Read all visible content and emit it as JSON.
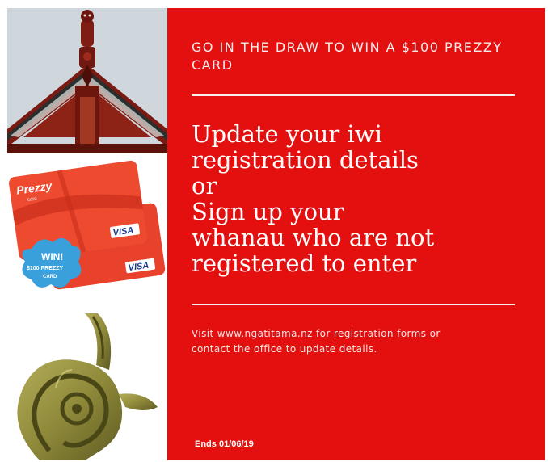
{
  "poster": {
    "headline_small": "GO IN THE DRAW TO WIN A $100 PREZZY CARD",
    "main_lines": [
      "Update your iwi",
      "registration details",
      "or",
      "Sign up your",
      "whanau who are not",
      "registered to enter"
    ],
    "body_text": "Visit www.ngatitama.nz for registration forms or contact the office to update details.",
    "ends": "Ends 01/06/19"
  },
  "prezzy_card": {
    "brand": "Prezzy",
    "brand_sub": "card",
    "card_network": "VISA",
    "badge_line1": "WIN!",
    "badge_line2": "$100 PREZZY",
    "badge_line3": "CARD"
  },
  "colors": {
    "panel_red": "#e41010",
    "card_red": "#e8412c",
    "badge_blue": "#3aa0dc",
    "pounamu_green": "#8f8a3a"
  },
  "icons": [
    "marae-carving-icon",
    "prezzy-card-icon",
    "win-badge-icon",
    "pounamu-hook-icon"
  ]
}
